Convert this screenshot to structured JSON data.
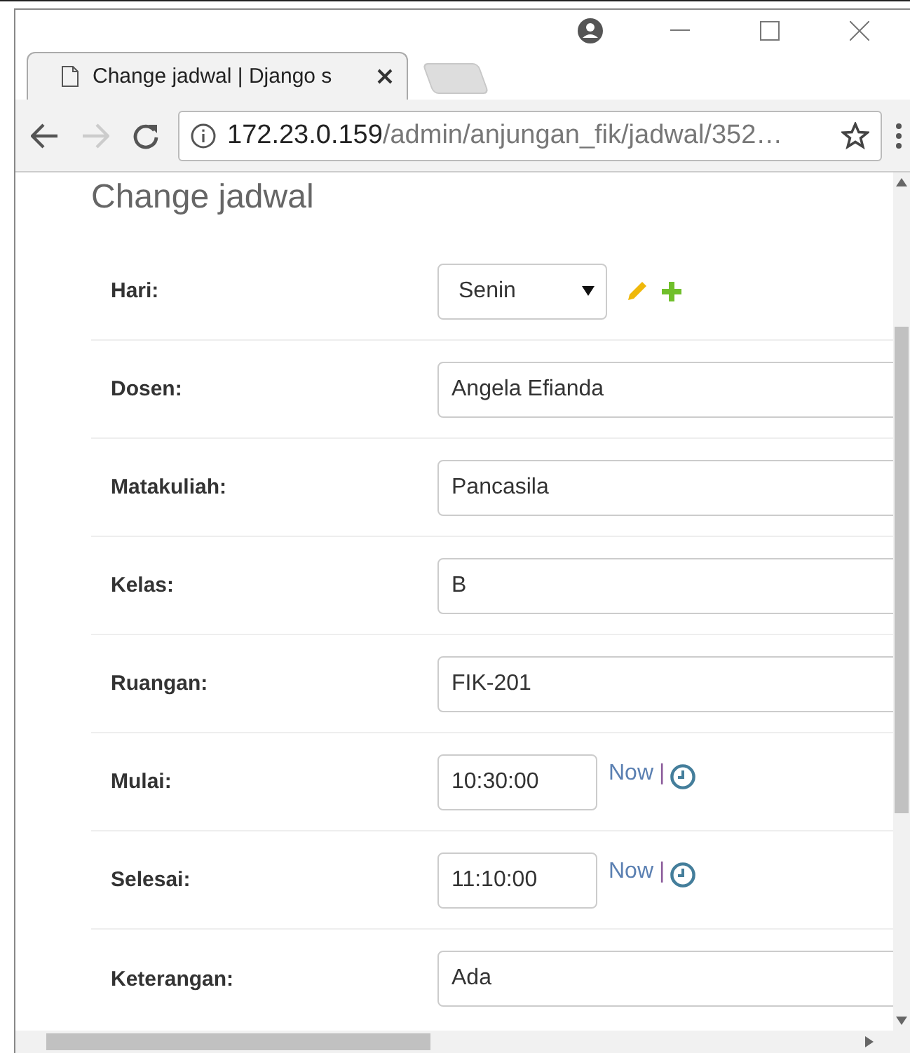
{
  "browser": {
    "tab_title": "Change jadwal | Django s",
    "url_host": "172.23.0.159",
    "url_path": "/admin/anjungan_fik/jadwal/352…"
  },
  "page": {
    "title": "Change jadwal"
  },
  "fields": [
    {
      "label": "Hari:",
      "kind": "select",
      "value": "Senin"
    },
    {
      "label": "Dosen:",
      "kind": "text",
      "value": "Angela Efianda"
    },
    {
      "label": "Matakuliah:",
      "kind": "text",
      "value": "Pancasila"
    },
    {
      "label": "Kelas:",
      "kind": "text",
      "value": "B"
    },
    {
      "label": "Ruangan:",
      "kind": "text",
      "value": "FIK-201"
    },
    {
      "label": "Mulai:",
      "kind": "time",
      "value": "10:30:00",
      "now": "Now",
      "separator": "|"
    },
    {
      "label": "Selesai:",
      "kind": "time",
      "value": "11:10:00",
      "now": "Now",
      "separator": "|"
    },
    {
      "label": "Keterangan:",
      "kind": "text",
      "value": "Ada"
    }
  ]
}
